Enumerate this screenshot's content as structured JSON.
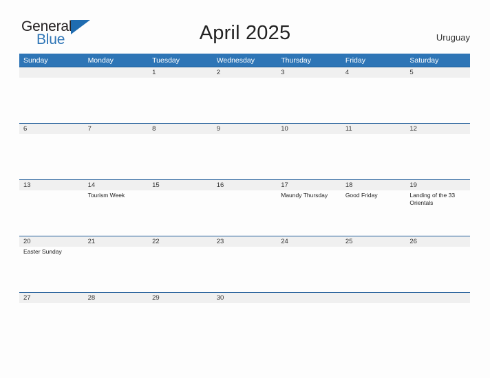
{
  "brand": {
    "name_top": "General",
    "name_bottom": "Blue",
    "triangle_color": "#1f6cb0",
    "text_color": "#231f20",
    "accent_color": "#2e75b6"
  },
  "header": {
    "title": "April 2025",
    "region": "Uruguay"
  },
  "colors": {
    "header_blue": "#2e75b6",
    "row_divider_blue": "#1f5c99",
    "date_strip_gray": "#f0f0f0",
    "page_background": "#fdfdfd",
    "text_dark": "#222222"
  },
  "calendar": {
    "weekdays": [
      "Sunday",
      "Monday",
      "Tuesday",
      "Wednesday",
      "Thursday",
      "Friday",
      "Saturday"
    ],
    "weeks": [
      {
        "days": [
          {
            "date": "",
            "event": ""
          },
          {
            "date": "",
            "event": ""
          },
          {
            "date": "1",
            "event": ""
          },
          {
            "date": "2",
            "event": ""
          },
          {
            "date": "3",
            "event": ""
          },
          {
            "date": "4",
            "event": ""
          },
          {
            "date": "5",
            "event": ""
          }
        ]
      },
      {
        "days": [
          {
            "date": "6",
            "event": ""
          },
          {
            "date": "7",
            "event": ""
          },
          {
            "date": "8",
            "event": ""
          },
          {
            "date": "9",
            "event": ""
          },
          {
            "date": "10",
            "event": ""
          },
          {
            "date": "11",
            "event": ""
          },
          {
            "date": "12",
            "event": ""
          }
        ]
      },
      {
        "days": [
          {
            "date": "13",
            "event": ""
          },
          {
            "date": "14",
            "event": "Tourism Week"
          },
          {
            "date": "15",
            "event": ""
          },
          {
            "date": "16",
            "event": ""
          },
          {
            "date": "17",
            "event": "Maundy Thursday"
          },
          {
            "date": "18",
            "event": "Good Friday"
          },
          {
            "date": "19",
            "event": "Landing of the 33 Orientals"
          }
        ]
      },
      {
        "days": [
          {
            "date": "20",
            "event": "Easter Sunday"
          },
          {
            "date": "21",
            "event": ""
          },
          {
            "date": "22",
            "event": ""
          },
          {
            "date": "23",
            "event": ""
          },
          {
            "date": "24",
            "event": ""
          },
          {
            "date": "25",
            "event": ""
          },
          {
            "date": "26",
            "event": ""
          }
        ]
      },
      {
        "days": [
          {
            "date": "27",
            "event": ""
          },
          {
            "date": "28",
            "event": ""
          },
          {
            "date": "29",
            "event": ""
          },
          {
            "date": "30",
            "event": ""
          },
          {
            "date": "",
            "event": ""
          },
          {
            "date": "",
            "event": ""
          },
          {
            "date": "",
            "event": ""
          }
        ]
      }
    ]
  }
}
